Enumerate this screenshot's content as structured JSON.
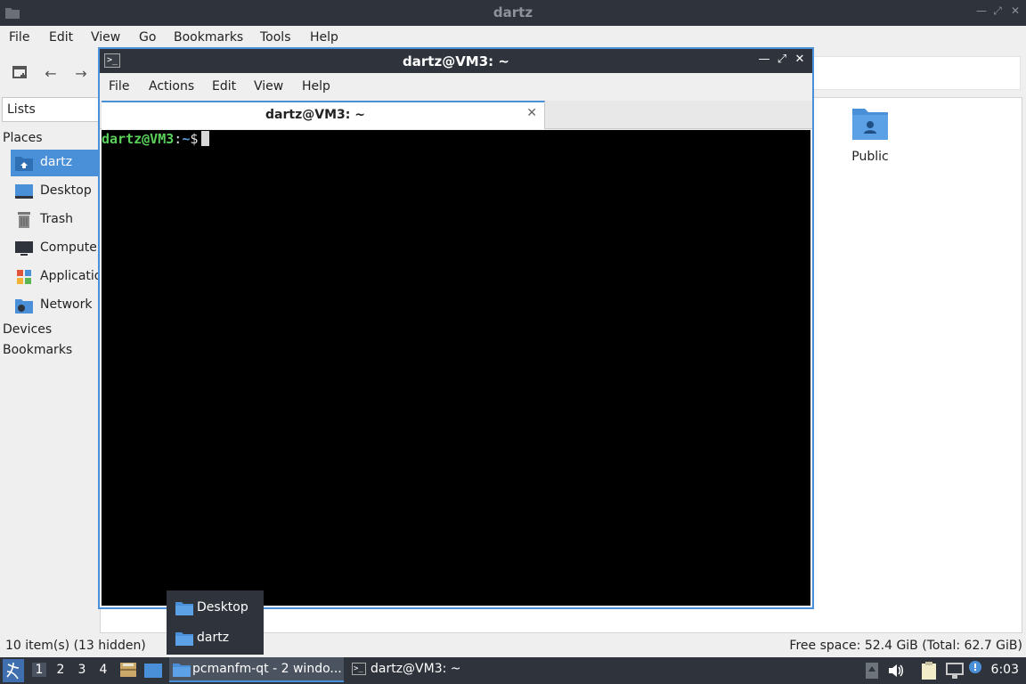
{
  "file_manager": {
    "title": "dartz",
    "menu": [
      "File",
      "Edit",
      "View",
      "Go",
      "Bookmarks",
      "Tools",
      "Help"
    ],
    "side_mode": "Lists",
    "places_header": "Places",
    "places": [
      {
        "label": "dartz",
        "icon": "home-folder-icon"
      },
      {
        "label": "Desktop",
        "icon": "desktop-icon"
      },
      {
        "label": "Trash",
        "icon": "trash-icon"
      },
      {
        "label": "Computer",
        "icon": "computer-icon"
      },
      {
        "label": "Applications",
        "icon": "applications-icon"
      },
      {
        "label": "Network",
        "icon": "network-icon"
      }
    ],
    "devices_header": "Devices",
    "bookmarks_header": "Bookmarks",
    "visible_item": "Public",
    "status_left": "10 item(s) (13 hidden)",
    "status_right": "Free space: 52.4 GiB (Total: 62.7 GiB)"
  },
  "terminal": {
    "title": "dartz@VM3: ~",
    "menu": [
      "File",
      "Actions",
      "Edit",
      "View",
      "Help"
    ],
    "tab_label": "dartz@VM3: ~",
    "prompt_user": "dartz@VM3",
    "prompt_sep": ":",
    "prompt_path": "~",
    "prompt_symbol": "$"
  },
  "taskbar_popup": {
    "items": [
      "Desktop",
      "dartz"
    ]
  },
  "panel": {
    "desktops": [
      "1",
      "2",
      "3",
      "4"
    ],
    "tasks": [
      "pcmanfm-qt - 2 windo...",
      "dartz@VM3: ~"
    ],
    "clock": "6:03"
  },
  "colors": {
    "accent": "#4a90d9",
    "titlebar": "#2f343c",
    "prompt_user": "#5ad25a",
    "prompt_path": "#5b9bd5"
  }
}
